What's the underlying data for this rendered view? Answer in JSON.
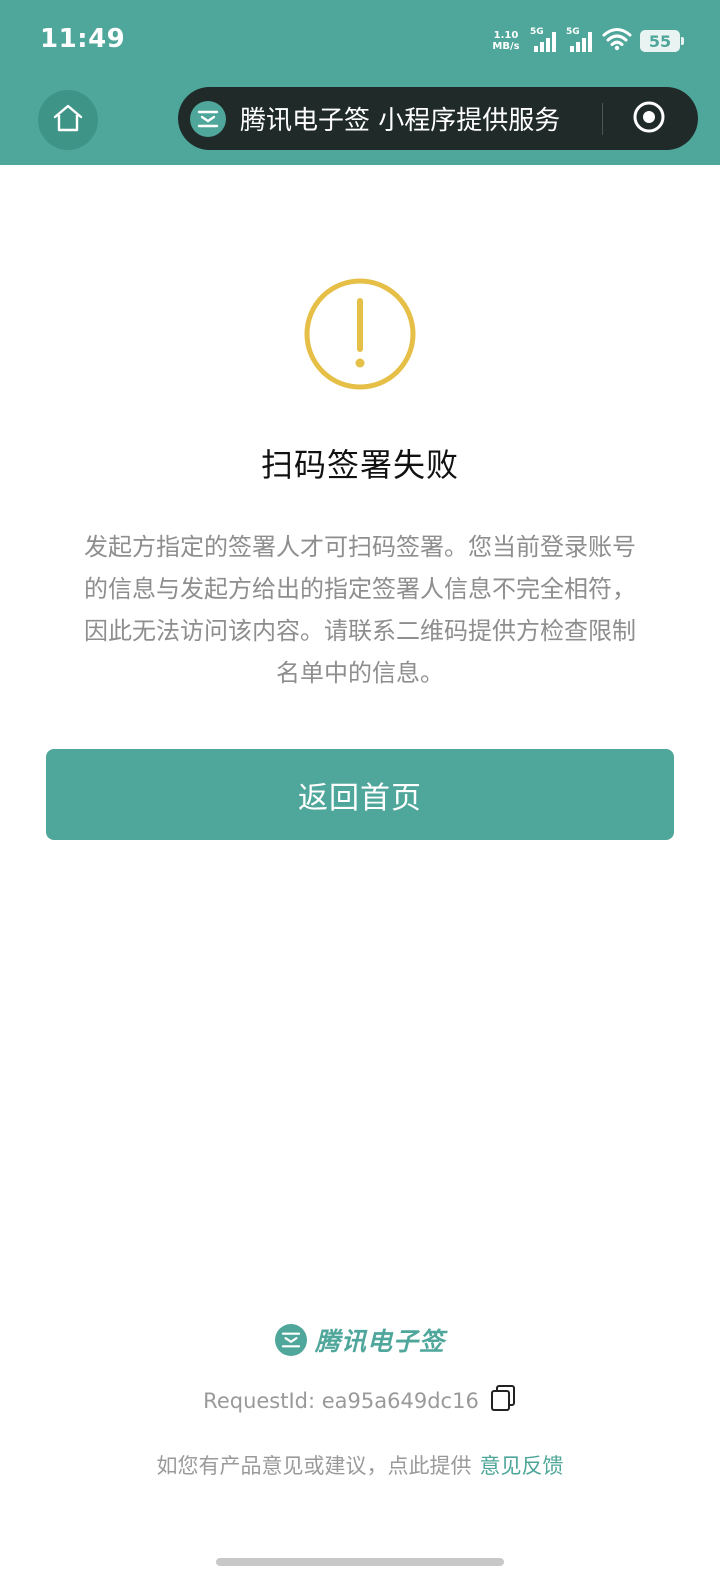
{
  "status_bar": {
    "time": "11:49",
    "net_speed_value": "1.10",
    "net_speed_unit": "MB/s",
    "signal1_label": "5G",
    "signal2_label": "5G",
    "battery": "55"
  },
  "nav": {
    "capsule_title": "腾讯电子签 小程序提供服务"
  },
  "main": {
    "title": "扫码签署失败",
    "description": "发起方指定的签署人才可扫码签署。您当前登录账号的信息与发起方给出的指定签署人信息不完全相符，因此无法访问该内容。请联系二维码提供方检查限制名单中的信息。",
    "button_label": "返回首页"
  },
  "footer": {
    "brand_name": "腾讯电子签",
    "request_id": "RequestId: ea95a649dc16",
    "feedback_prefix": "如您有产品意见或建议，点此提供",
    "feedback_link": "意见反馈"
  },
  "colors": {
    "primary": "#4fa69a",
    "warning": "#e6bf47",
    "capsule_bg": "#1f2a29"
  },
  "icons": {
    "home": "home-icon",
    "brand_logo": "brand-logo-icon",
    "target": "target-icon",
    "warning": "warning-icon",
    "copy": "copy-icon",
    "wifi": "wifi-icon"
  }
}
